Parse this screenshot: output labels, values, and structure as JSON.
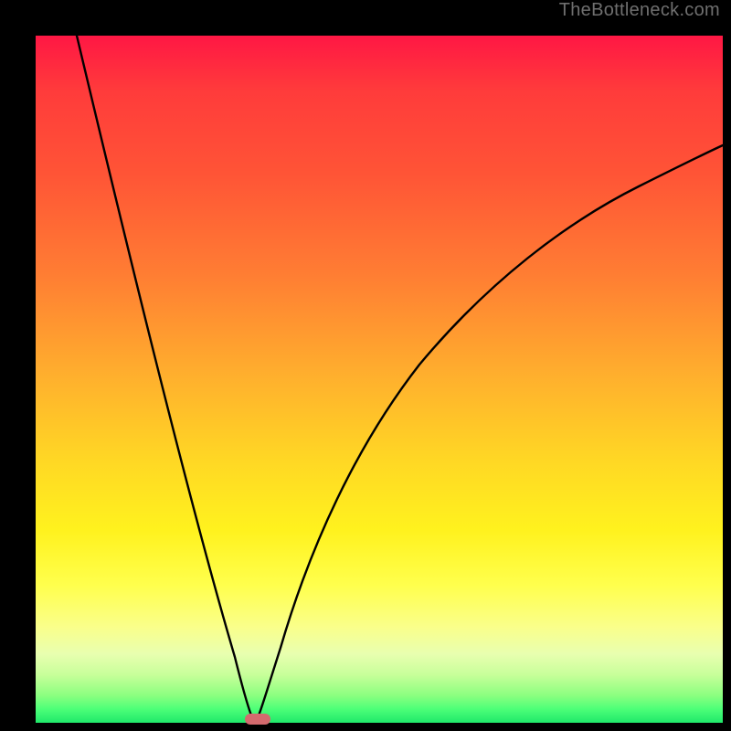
{
  "watermark": "TheBottleneck.com",
  "chart_data": {
    "type": "line",
    "title": "",
    "xlabel": "",
    "ylabel": "",
    "xlim": [
      0,
      100
    ],
    "ylim": [
      0,
      100
    ],
    "grid": false,
    "legend": false,
    "curve_description": "V-shaped bottleneck curve: steep left descent from ~100 at x≈6 to 0 at x≈32, then asymptotic rise toward ~84 at x=100",
    "x": [
      6,
      10,
      14,
      18,
      22,
      26,
      30,
      32,
      34,
      38,
      42,
      46,
      50,
      54,
      58,
      62,
      66,
      70,
      74,
      78,
      82,
      86,
      90,
      94,
      98,
      100
    ],
    "y": [
      100,
      85,
      70,
      55,
      40,
      25,
      8,
      0,
      6,
      18,
      29,
      38,
      46,
      52,
      57,
      62,
      66,
      69,
      72,
      74,
      77,
      79,
      80,
      82,
      83,
      84
    ],
    "optimal_marker": {
      "x": 32,
      "y": 0
    },
    "colors": {
      "gradient_top": "#ff1744",
      "gradient_bottom": "#1fe86a",
      "curve": "#000000",
      "marker": "#d46a6e"
    }
  }
}
